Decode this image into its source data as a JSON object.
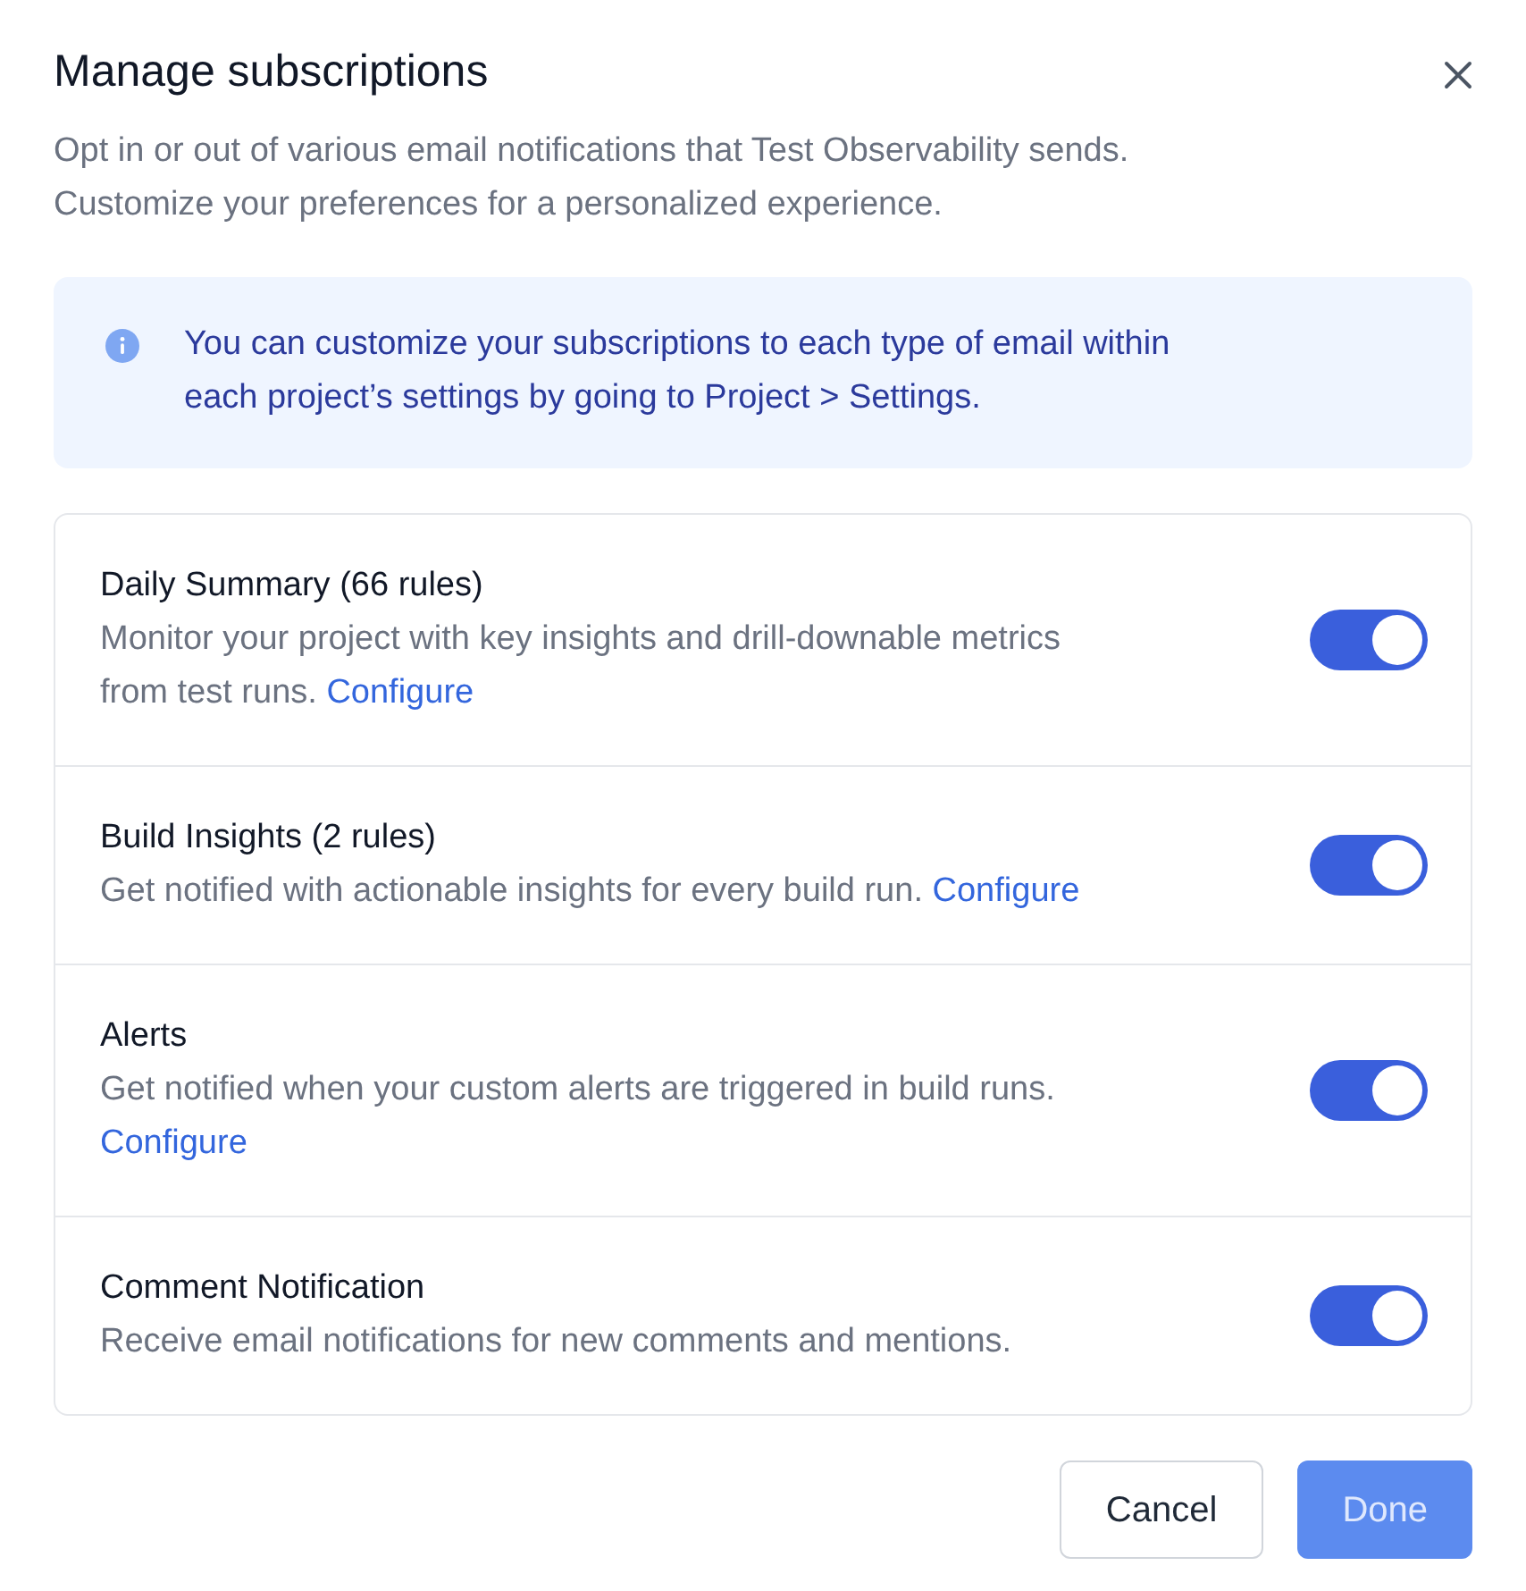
{
  "dialog": {
    "title": "Manage subscriptions",
    "description": "Opt in or out of various email notifications that Test Observability sends. Customize your preferences for a personalized experience.",
    "info": "You can customize your subscriptions to each type of email within each project’s settings by going to Project > Settings.",
    "subscriptions": [
      {
        "title": "Daily Summary (66 rules)",
        "description": "Monitor your project with key insights and drill-downable metrics from test runs.",
        "link": "Configure",
        "on": true
      },
      {
        "title": "Build Insights (2 rules)",
        "description": "Get notified with actionable insights for every build run.",
        "link": "Configure",
        "on": true
      },
      {
        "title": "Alerts",
        "description": "Get notified when your custom alerts are triggered in build runs.",
        "link": "Configure",
        "on": true
      },
      {
        "title": "Comment Notification",
        "description": "Receive email notifications for new comments and mentions.",
        "on": true
      }
    ],
    "buttons": [
      {
        "label": "Cancel",
        "kind": "secondary",
        "disabled": false
      },
      {
        "label": "Done",
        "kind": "primary",
        "disabled": true
      }
    ]
  }
}
